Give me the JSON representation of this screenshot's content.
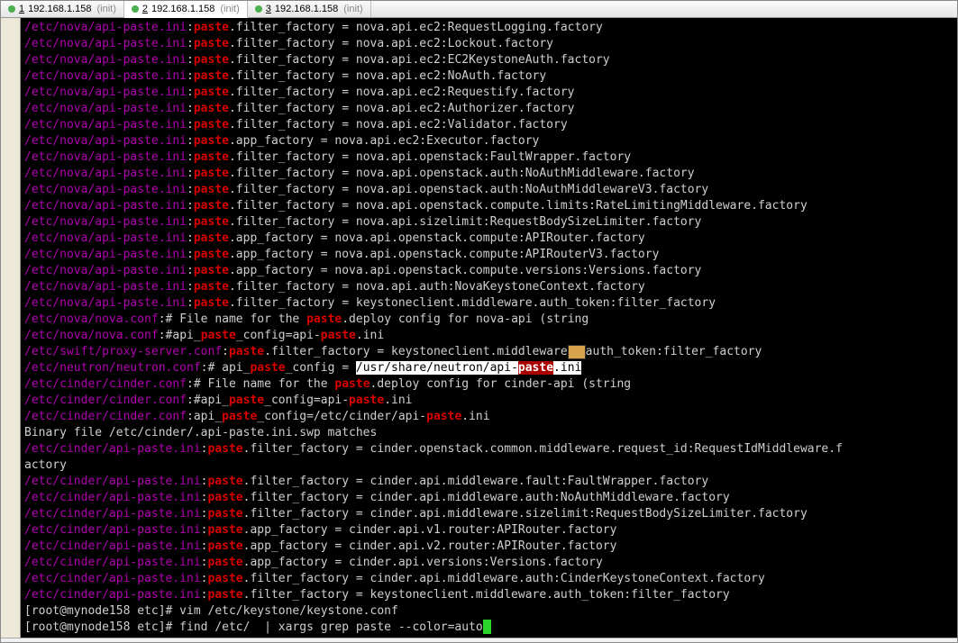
{
  "tabs": [
    {
      "num": "1",
      "label": "192.168.1.158",
      "status": "(init)",
      "active": false
    },
    {
      "num": "2",
      "label": "192.168.1.158",
      "status": "(init)",
      "active": true
    },
    {
      "num": "3",
      "label": "192.168.1.158",
      "status": "(init)",
      "active": false
    }
  ],
  "lines": [
    {
      "path": "/etc/nova/api-paste.ini",
      "k": "paste",
      "rest": ".filter_factory = nova.api.ec2:RequestLogging.factory"
    },
    {
      "path": "/etc/nova/api-paste.ini",
      "k": "paste",
      "rest": ".filter_factory = nova.api.ec2:Lockout.factory"
    },
    {
      "path": "/etc/nova/api-paste.ini",
      "k": "paste",
      "rest": ".filter_factory = nova.api.ec2:EC2KeystoneAuth.factory"
    },
    {
      "path": "/etc/nova/api-paste.ini",
      "k": "paste",
      "rest": ".filter_factory = nova.api.ec2:NoAuth.factory"
    },
    {
      "path": "/etc/nova/api-paste.ini",
      "k": "paste",
      "rest": ".filter_factory = nova.api.ec2:Requestify.factory"
    },
    {
      "path": "/etc/nova/api-paste.ini",
      "k": "paste",
      "rest": ".filter_factory = nova.api.ec2:Authorizer.factory"
    },
    {
      "path": "/etc/nova/api-paste.ini",
      "k": "paste",
      "rest": ".filter_factory = nova.api.ec2:Validator.factory"
    },
    {
      "path": "/etc/nova/api-paste.ini",
      "k": "paste",
      "rest": ".app_factory = nova.api.ec2:Executor.factory"
    },
    {
      "path": "/etc/nova/api-paste.ini",
      "k": "paste",
      "rest": ".filter_factory = nova.api.openstack:FaultWrapper.factory"
    },
    {
      "path": "/etc/nova/api-paste.ini",
      "k": "paste",
      "rest": ".filter_factory = nova.api.openstack.auth:NoAuthMiddleware.factory"
    },
    {
      "path": "/etc/nova/api-paste.ini",
      "k": "paste",
      "rest": ".filter_factory = nova.api.openstack.auth:NoAuthMiddlewareV3.factory"
    },
    {
      "path": "/etc/nova/api-paste.ini",
      "k": "paste",
      "rest": ".filter_factory = nova.api.openstack.compute.limits:RateLimitingMiddleware.factory"
    },
    {
      "path": "/etc/nova/api-paste.ini",
      "k": "paste",
      "rest": ".filter_factory = nova.api.sizelimit:RequestBodySizeLimiter.factory"
    },
    {
      "path": "/etc/nova/api-paste.ini",
      "k": "paste",
      "rest": ".app_factory = nova.api.openstack.compute:APIRouter.factory"
    },
    {
      "path": "/etc/nova/api-paste.ini",
      "k": "paste",
      "rest": ".app_factory = nova.api.openstack.compute:APIRouterV3.factory"
    },
    {
      "path": "/etc/nova/api-paste.ini",
      "k": "paste",
      "rest": ".app_factory = nova.api.openstack.compute.versions:Versions.factory"
    },
    {
      "path": "/etc/nova/api-paste.ini",
      "k": "paste",
      "rest": ".filter_factory = nova.api.auth:NovaKeystoneContext.factory"
    },
    {
      "path": "/etc/nova/api-paste.ini",
      "k": "paste",
      "rest": ".filter_factory = keystoneclient.middleware.auth_token:filter_factory"
    }
  ],
  "nova_conf1": {
    "path": "/etc/nova/nova.conf",
    "pre": ":# File name for the ",
    "k": "paste",
    "post": ".deploy config for nova-api (string"
  },
  "nova_conf2": {
    "path": "/etc/nova/nova.conf",
    "pre": ":#api_",
    "k": "paste",
    "mid": "_config=api-",
    "k2": "paste",
    "post": ".ini"
  },
  "swift": {
    "path": "/etc/swift/proxy-server.conf",
    "k": "paste",
    "rest": ".filter_factory = keystoneclient.middleware",
    "post": "auth_token:filter_factory",
    "icon": true
  },
  "neutron": {
    "path": "/etc/neutron/neutron.conf",
    "pre": ":# api_",
    "k": "paste",
    "mid": "_config = ",
    "sel_pre": "/usr/share/neutron/api-",
    "sel_k": "paste",
    "sel_post": ".ini"
  },
  "cinder_conf1": {
    "path": "/etc/cinder/cinder.conf",
    "pre": ":# File name for the ",
    "k": "paste",
    "post": ".deploy config for cinder-api (string"
  },
  "cinder_conf2": {
    "path": "/etc/cinder/cinder.conf",
    "pre": ":#api_",
    "k": "paste",
    "mid": "_config=api-",
    "k2": "paste",
    "post": ".ini"
  },
  "cinder_conf3": {
    "path": "/etc/cinder/cinder.conf",
    "pre": ":api_",
    "k": "paste",
    "post": "_config=/etc/cinder/api-",
    "k2": "paste",
    "post2": ".ini"
  },
  "binary": "Binary file /etc/cinder/.api-paste.ini.swp matches",
  "cinder_lines": [
    {
      "path": "/etc/cinder/api-paste.ini",
      "k": "paste",
      "rest": ".filter_factory = cinder.openstack.common.middleware.request_id:RequestIdMiddleware.f",
      "wrap": "actory"
    },
    {
      "path": "/etc/cinder/api-paste.ini",
      "k": "paste",
      "rest": ".filter_factory = cinder.api.middleware.fault:FaultWrapper.factory"
    },
    {
      "path": "/etc/cinder/api-paste.ini",
      "k": "paste",
      "rest": ".filter_factory = cinder.api.middleware.auth:NoAuthMiddleware.factory"
    },
    {
      "path": "/etc/cinder/api-paste.ini",
      "k": "paste",
      "rest": ".filter_factory = cinder.api.middleware.sizelimit:RequestBodySizeLimiter.factory"
    },
    {
      "path": "/etc/cinder/api-paste.ini",
      "k": "paste",
      "rest": ".app_factory = cinder.api.v1.router:APIRouter.factory"
    },
    {
      "path": "/etc/cinder/api-paste.ini",
      "k": "paste",
      "rest": ".app_factory = cinder.api.v2.router:APIRouter.factory"
    },
    {
      "path": "/etc/cinder/api-paste.ini",
      "k": "paste",
      "rest": ".app_factory = cinder.api.versions:Versions.factory"
    },
    {
      "path": "/etc/cinder/api-paste.ini",
      "k": "paste",
      "rest": ".filter_factory = cinder.api.middleware.auth:CinderKeystoneContext.factory"
    },
    {
      "path": "/etc/cinder/api-paste.ini",
      "k": "paste",
      "rest": ".filter_factory = keystoneclient.middleware.auth_token:filter_factory"
    }
  ],
  "prompt1": {
    "pre": "[root@mynode158 etc]# ",
    "cmd": "vim /etc/keystone/keystone.conf"
  },
  "prompt2": {
    "pre": "[root@mynode158 etc]# ",
    "cmd": "find /etc/  | xargs grep paste --color=auto"
  }
}
